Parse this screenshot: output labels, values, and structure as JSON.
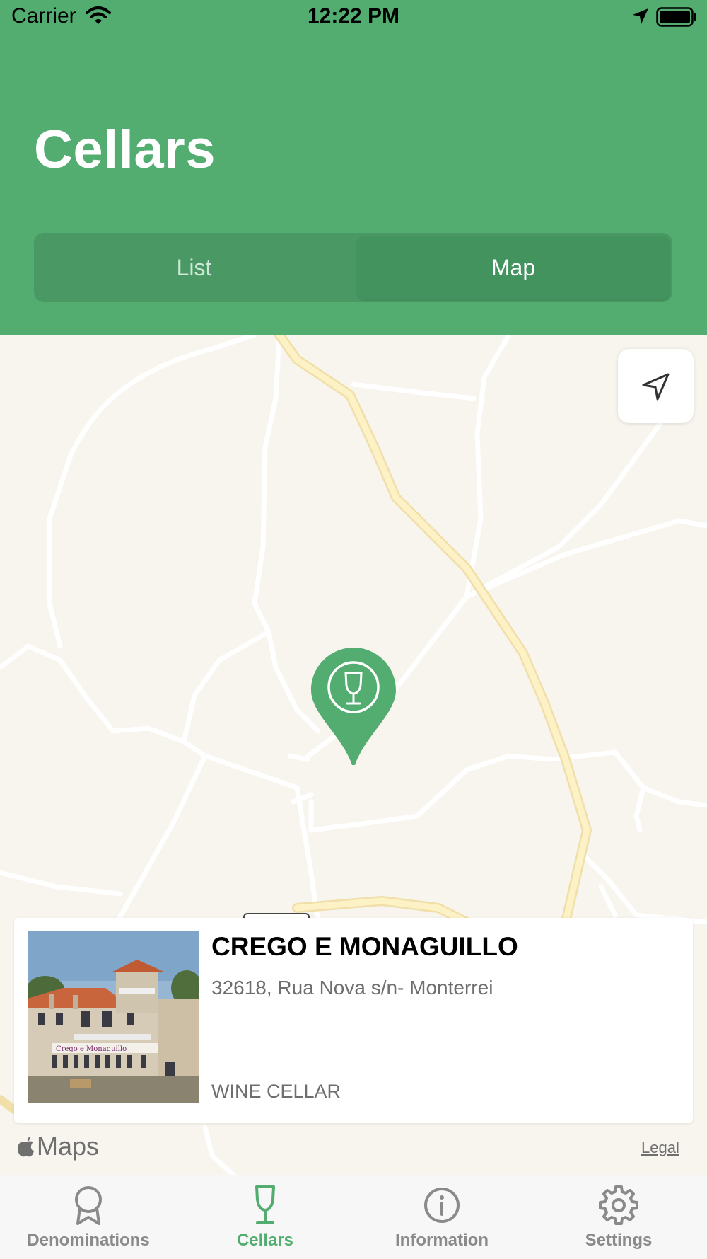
{
  "status_bar": {
    "carrier": "Carrier",
    "time": "12:22 PM"
  },
  "header": {
    "title": "Cellars",
    "segments": [
      {
        "label": "List",
        "selected": false
      },
      {
        "label": "Map",
        "selected": true
      }
    ]
  },
  "map": {
    "pin_icon": "wine-glass-icon",
    "locate_icon": "location-arrow-icon",
    "attribution": "Maps",
    "legal": "Legal"
  },
  "callout": {
    "name": "CREGO E MONAGUILLO",
    "address": "32618, Rua Nova s/n- Monterrei",
    "type": "WINE CELLAR",
    "photo_caption": "Crego e Monaguillo"
  },
  "tabbar": {
    "items": [
      {
        "label": "Denominations",
        "icon": "award-ribbon-icon",
        "active": false
      },
      {
        "label": "Cellars",
        "icon": "wine-glass-icon",
        "active": true
      },
      {
        "label": "Information",
        "icon": "info-circle-icon",
        "active": false
      },
      {
        "label": "Settings",
        "icon": "gear-icon",
        "active": false
      }
    ]
  },
  "colors": {
    "brand_green": "#53ad70",
    "segment_bg": "#4a9964",
    "map_bg": "#f8f4ee",
    "major_road": "#fbe8b0"
  }
}
